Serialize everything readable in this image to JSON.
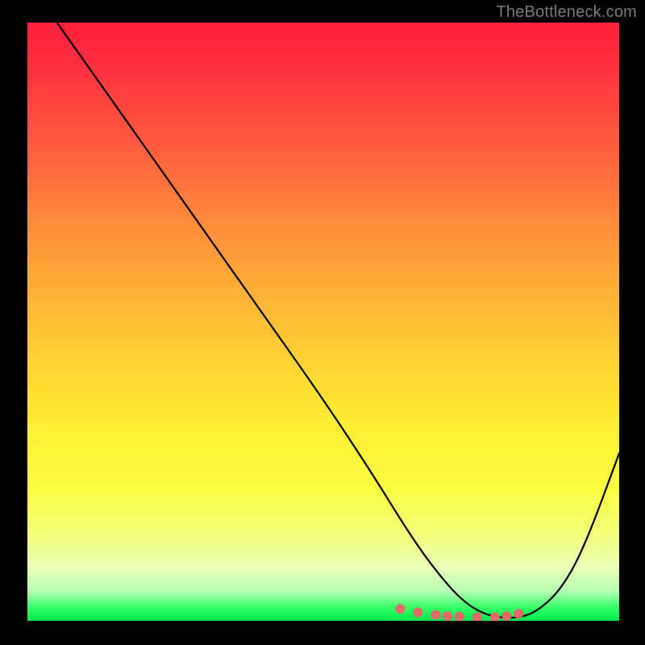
{
  "watermark": "TheBottleneck.com",
  "chart_data": {
    "type": "line",
    "title": "",
    "xlabel": "",
    "ylabel": "",
    "xlim": [
      0,
      100
    ],
    "ylim": [
      0,
      100
    ],
    "series": [
      {
        "name": "curve",
        "stroke": "#000000",
        "stroke_width": 2.2,
        "x": [
          5,
          10,
          20,
          30,
          40,
          50,
          58,
          63,
          67,
          71,
          74,
          77,
          80,
          83,
          86,
          90,
          94,
          100
        ],
        "y": [
          100,
          93,
          79,
          65,
          51,
          37,
          25,
          17,
          11,
          6,
          3,
          1.2,
          0.5,
          0.5,
          1.5,
          5,
          12,
          28
        ]
      },
      {
        "name": "highlight-dots",
        "stroke": "#e46a6a",
        "type_hint": "scatter",
        "marker_radius": 6,
        "x": [
          63,
          66,
          69,
          71,
          73,
          76,
          79,
          81,
          83
        ],
        "y": [
          2.0,
          1.4,
          1.0,
          0.8,
          0.7,
          0.6,
          0.6,
          0.8,
          1.2
        ]
      }
    ],
    "background_gradient": {
      "top": "#ff1f3e",
      "mid": "#ffe733",
      "bottom": "#00e84e"
    }
  }
}
